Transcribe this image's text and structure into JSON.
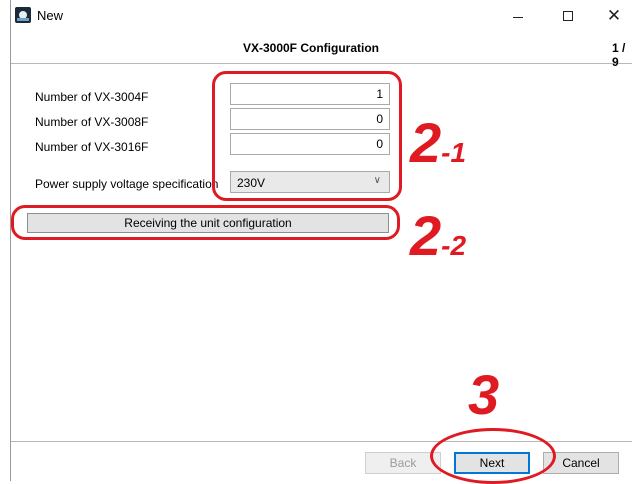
{
  "window": {
    "title": "New",
    "controls": [
      "minimize-icon",
      "maximize-icon",
      "close-icon"
    ],
    "close_glyph": "✕"
  },
  "header": {
    "title": "VX-3000F Configuration",
    "page": "1 / 9"
  },
  "form": {
    "vx3004f_label": "Number of VX-3004F",
    "vx3004f_value": "1",
    "vx3008f_label": "Number of VX-3008F",
    "vx3008f_value": "0",
    "vx3016f_label": "Number of VX-3016F",
    "vx3016f_value": "0",
    "voltage_label": "Power supply voltage specification",
    "voltage_value": "230V",
    "receive_button": "Receiving the unit configuration"
  },
  "footer": {
    "back": "Back",
    "next": "Next",
    "cancel": "Cancel"
  },
  "annotations": {
    "step_2_1_big": "2",
    "step_2_1_sub": "-1",
    "step_2_2_big": "2",
    "step_2_2_sub": "-2",
    "step_3": "3",
    "color": "#e01a22"
  },
  "colors": {
    "accent_focus": "#0078d7"
  }
}
